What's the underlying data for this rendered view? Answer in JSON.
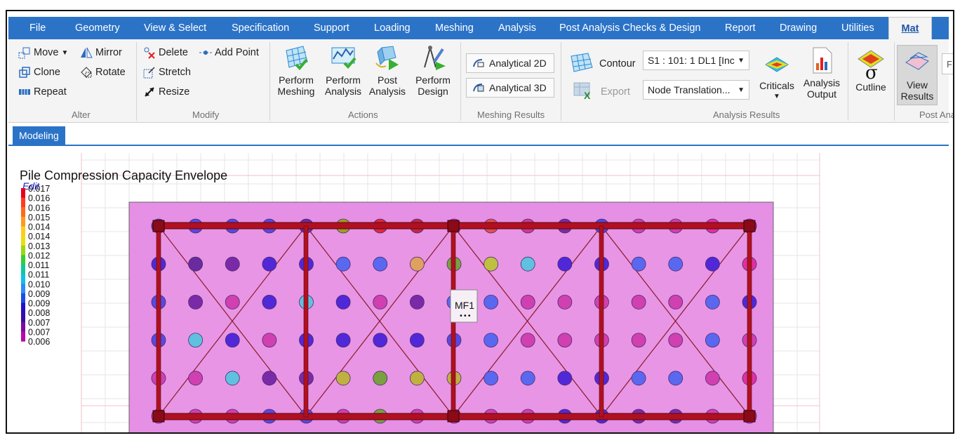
{
  "menu": [
    "File",
    "Geometry",
    "View & Select",
    "Specification",
    "Support",
    "Loading",
    "Meshing",
    "Analysis",
    "Post Analysis Checks & Design",
    "Report",
    "Drawing",
    "Utilities",
    "Mat"
  ],
  "ribbon": {
    "alter": {
      "move": "Move",
      "mirror": "Mirror",
      "clone": "Clone",
      "rotate": "Rotate",
      "repeat": "Repeat",
      "label": "Alter"
    },
    "modify": {
      "delete": "Delete",
      "add_point": "Add Point",
      "stretch": "Stretch",
      "resize": "Resize",
      "label": "Modify"
    },
    "actions": {
      "perform_meshing": [
        "Perform",
        "Meshing"
      ],
      "perform_analysis": [
        "Perform",
        "Analysis"
      ],
      "post_analysis": [
        "Post",
        "Analysis"
      ],
      "perform_design": [
        "Perform",
        "Design"
      ],
      "label": "Actions"
    },
    "meshing_results": {
      "analytical_2d": "Analytical 2D",
      "analytical_3d": "Analytical 3D",
      "label": "Meshing Results"
    },
    "analysis_results": {
      "contour": "Contour",
      "load_case": "S1 : 101: 1 DL1 [Inc",
      "export": "Export",
      "result_type": "Node Translation...",
      "criticals": "Criticals",
      "analysis_output": [
        "Analysis",
        "Output"
      ],
      "cutline": "Cutline",
      "label": "Analysis Results"
    },
    "post_analysis": {
      "view_results": [
        "View",
        "Results"
      ],
      "label": "Post Ana",
      "cut_char": "F"
    }
  },
  "doc_tab": "Modeling",
  "plot": {
    "title": "Pile Compression Capacity Envelope",
    "edit_link": "Edit",
    "legend_values": [
      "0.017",
      "0.016",
      "0.016",
      "0.015",
      "0.014",
      "0.014",
      "0.013",
      "0.012",
      "0.011",
      "0.011",
      "0.010",
      "0.009",
      "0.009",
      "0.008",
      "0.007",
      "0.007",
      "0.006"
    ],
    "legend_colors": [
      "#e8001c",
      "#ff3c1e",
      "#ff6a1e",
      "#ff9a1e",
      "#ffcc1e",
      "#e8e010",
      "#9ad810",
      "#36cc36",
      "#10c8a0",
      "#10c0e8",
      "#2e8cf0",
      "#1c4ce8",
      "#2010c8",
      "#3a0ca8",
      "#7a0aa0",
      "#b40aa8",
      "#e800c8"
    ],
    "grid_colors": [
      [
        "#5a2aa8",
        "#5a48e0",
        "#5a48e0",
        "#5a48e0",
        "#6a2aa0",
        "#9aa020",
        "#e02840",
        "#c02848",
        "#e03090",
        "#e05050",
        "#d03890",
        "#7a2aa8",
        "#5048e0",
        "#d040b0",
        "#d040b0",
        "#e030a0",
        "#c02070"
      ],
      [
        "#5028d8",
        "#6a2aa0",
        "#7a2aa8",
        "#5028d8",
        "#5028d8",
        "#5a68f0",
        "#5a68f0",
        "#e0a060",
        "#7aa040",
        "#c0c040",
        "#60c0e0",
        "#5028d8",
        "#5028d8",
        "#5a68f0",
        "#5a68f0",
        "#5028d8",
        "#e030a0"
      ],
      [
        "#5a48e0",
        "#7a2aa8",
        "#d040b0",
        "#5028d8",
        "#60c0e0",
        "#5028d8",
        "#d040b0",
        "#7a2aa8",
        "#5a68f0",
        "#5a68f0",
        "#d040b0",
        "#d040b0",
        "#d040b0",
        "#d040b0",
        "#d040b0",
        "#5a68f0",
        "#5028d8"
      ],
      [
        "#5a48e0",
        "#60c0e0",
        "#5028d8",
        "#d040b0",
        "#5028d8",
        "#5028d8",
        "#5028d8",
        "#5028d8",
        "#5a48e0",
        "#5a68f0",
        "#d040b0",
        "#d040b0",
        "#d040b0",
        "#d040b0",
        "#d040b0",
        "#5a68f0",
        "#d040b0"
      ],
      [
        "#d040b0",
        "#d040b0",
        "#60c0e0",
        "#7a2aa8",
        "#7a2aa8",
        "#c0b040",
        "#7aa040",
        "#c0b040",
        "#c0b040",
        "#5a68f0",
        "#5a68f0",
        "#5028d8",
        "#5028d8",
        "#5a68f0",
        "#5a68f0",
        "#d040b0",
        "#e030a0"
      ],
      [
        "#d040b0",
        "#d040b0",
        "#d040b0",
        "#5a48e0",
        "#5a48e0",
        "#d040b0",
        "#7aa040",
        "#d040b0",
        "#d040b0",
        "#d040b0",
        "#d040b0",
        "#5028d8",
        "#5028d8",
        "#7a2aa8",
        "#7a2aa8",
        "#d040b0",
        "#d040b0"
      ]
    ],
    "tag_label": "MF1",
    "tag_dots": "•••"
  }
}
